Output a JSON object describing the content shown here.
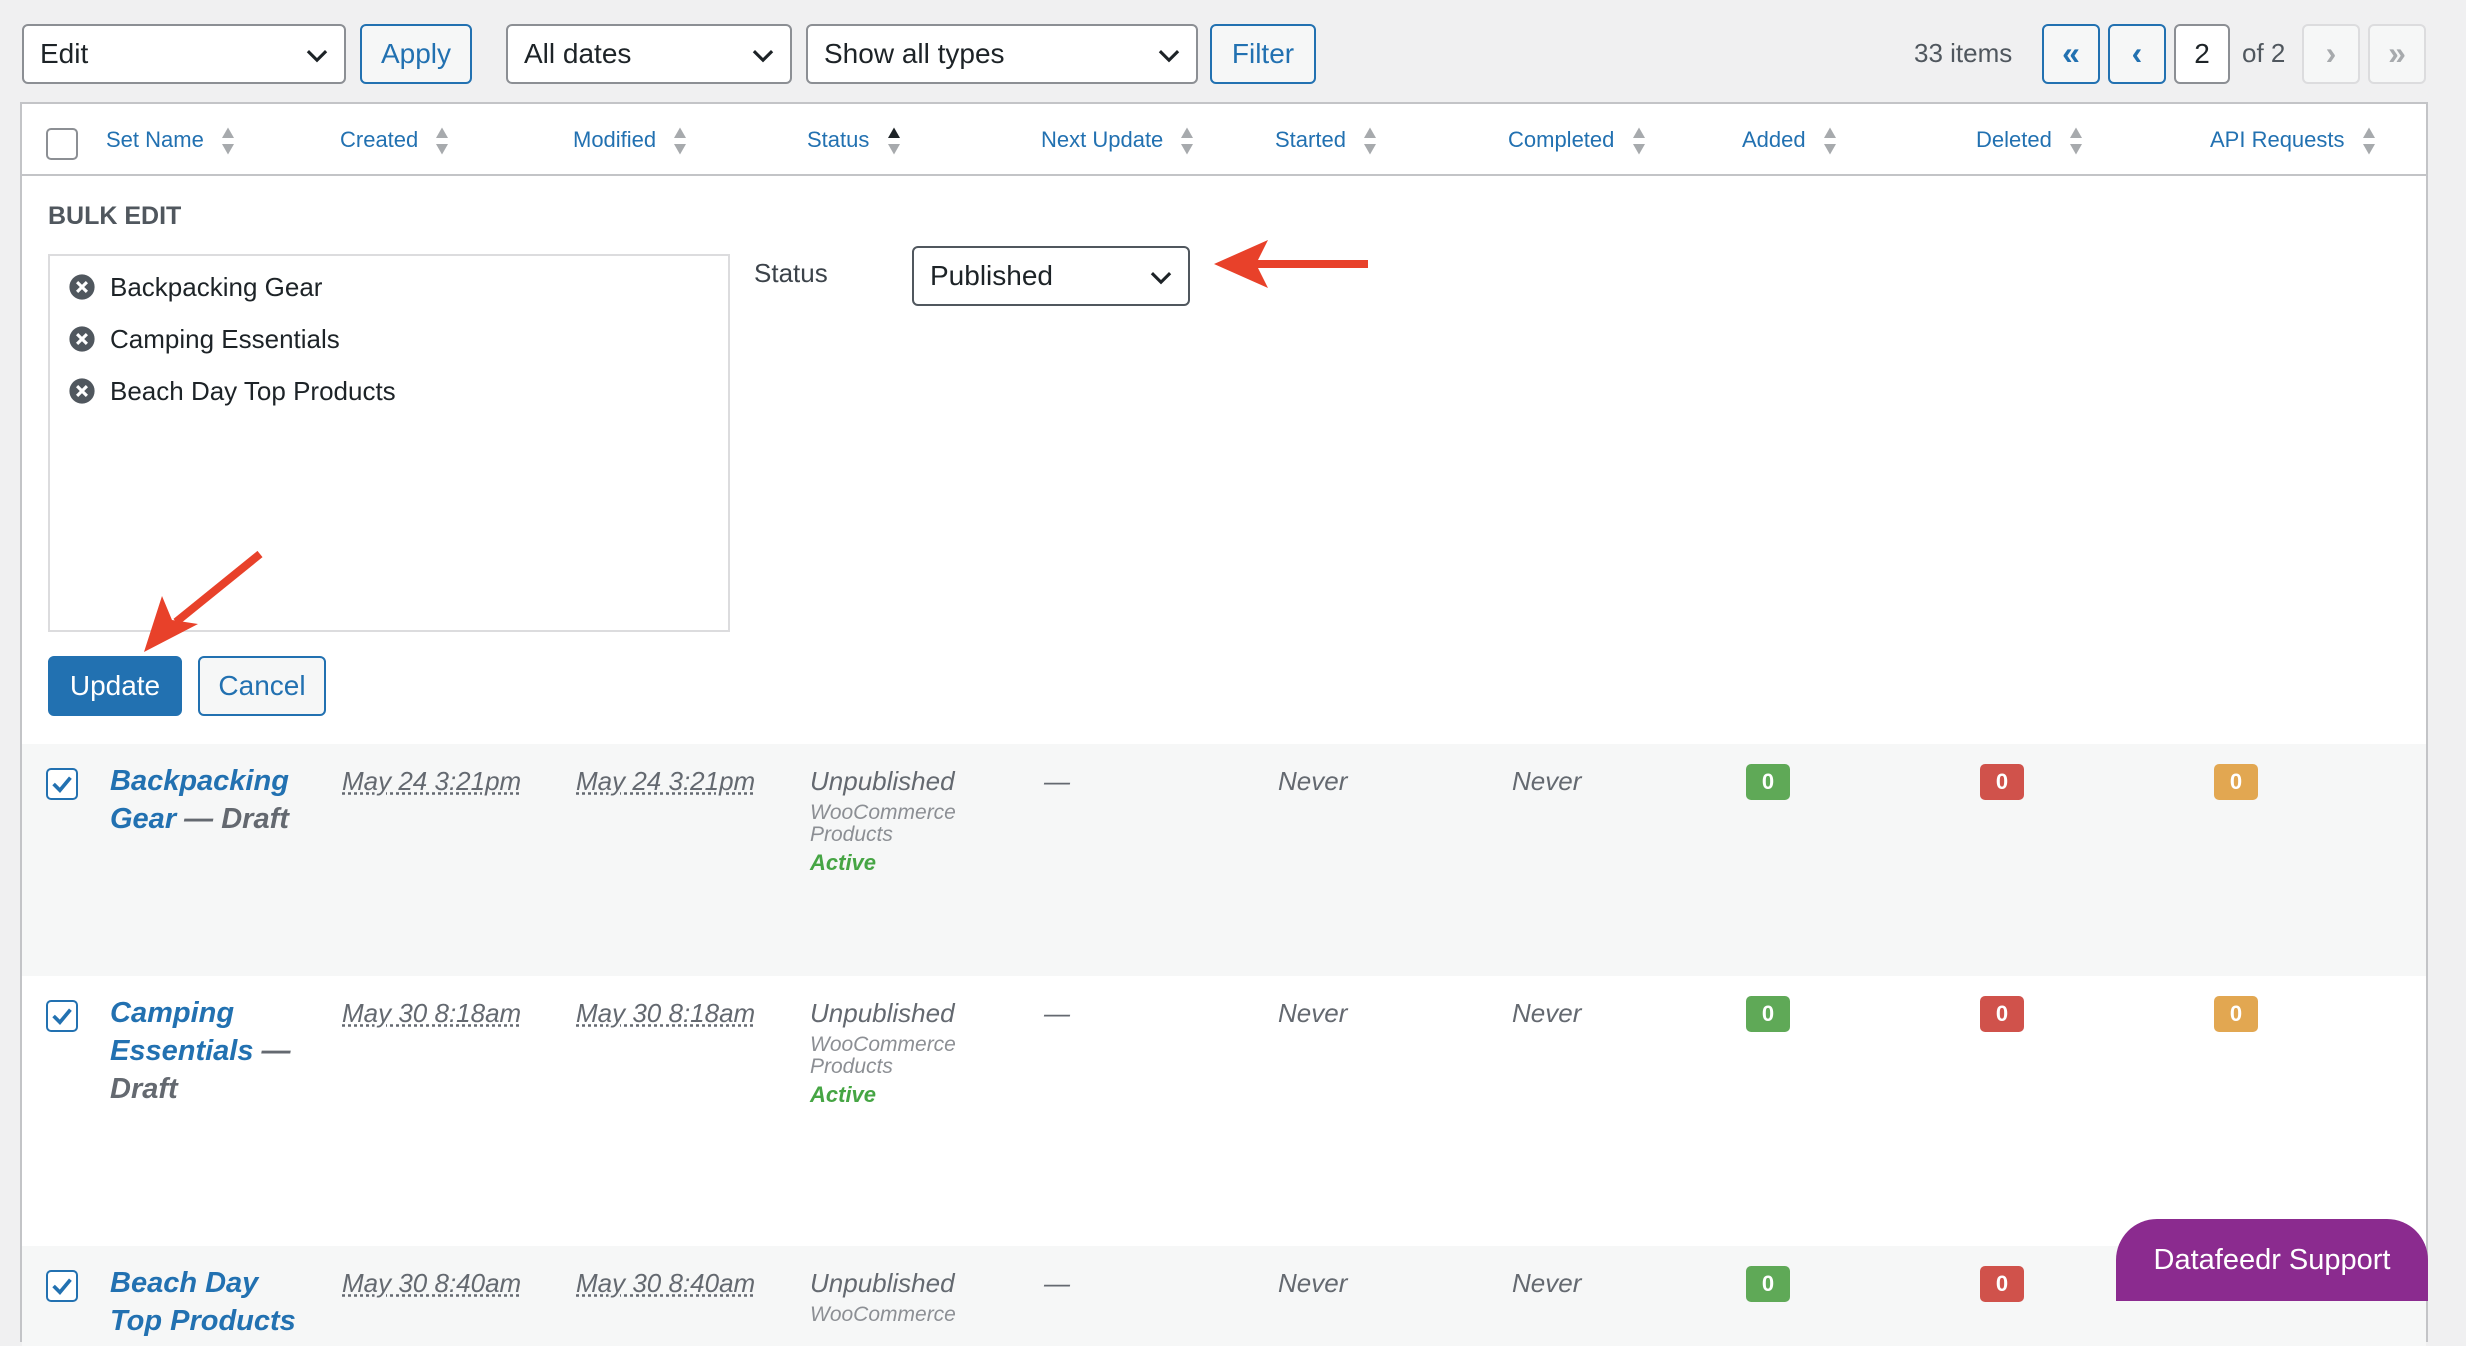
{
  "toolbar": {
    "bulk_action": "Edit",
    "apply_label": "Apply",
    "date_filter": "All dates",
    "type_filter": "Show all types",
    "filter_label": "Filter"
  },
  "pagination": {
    "items_count": "33 items",
    "first": "«",
    "prev": "‹",
    "current_page": "2",
    "of_total": "of 2",
    "next": "›",
    "last": "»"
  },
  "columns": [
    "Set Name",
    "Created",
    "Modified",
    "Status",
    "Next Update",
    "Started",
    "Completed",
    "Added",
    "Deleted",
    "API Requests"
  ],
  "bulk_edit": {
    "title": "BULK EDIT",
    "items": [
      "Backpacking Gear",
      "Camping Essentials",
      "Beach Day Top Products"
    ],
    "status_label": "Status",
    "status_value": "Published",
    "update_label": "Update",
    "cancel_label": "Cancel"
  },
  "rows": [
    {
      "name_line1": "Backpacking",
      "name_line2": "Gear",
      "name_state": "— Draft",
      "created": "May 24 3:21pm",
      "modified": "May 24 3:21pm",
      "status": "Unpublished",
      "type": "WooCommerce Products",
      "type_line1": "WooCommerce",
      "type_line2": "Products",
      "active": "Active",
      "next_update": "—",
      "started": "Never",
      "completed": "Never",
      "added": "0",
      "deleted": "0",
      "api": "0"
    },
    {
      "name_line1": "Camping",
      "name_line2": "Essentials",
      "name_state": "—",
      "name_state2": "Draft",
      "created": "May 30 8:18am",
      "modified": "May 30 8:18am",
      "status": "Unpublished",
      "type_line1": "WooCommerce",
      "type_line2": "Products",
      "active": "Active",
      "next_update": "—",
      "started": "Never",
      "completed": "Never",
      "added": "0",
      "deleted": "0",
      "api": "0"
    },
    {
      "name_line1": "Beach Day",
      "name_line2": "Top Products",
      "created": "May 30 8:40am",
      "modified": "May 30 8:40am",
      "status": "Unpublished",
      "type_line1": "WooCommerce",
      "next_update": "—",
      "started": "Never",
      "completed": "Never",
      "added": "0",
      "deleted": "0"
    }
  ],
  "support_label": "Datafeedr Support",
  "colors": {
    "accent": "#2271b1",
    "added_badge": "#5fa957",
    "deleted_badge": "#d0524b",
    "api_badge": "#e2a751",
    "arrow": "#e8412a",
    "support": "#8b2b8f"
  }
}
